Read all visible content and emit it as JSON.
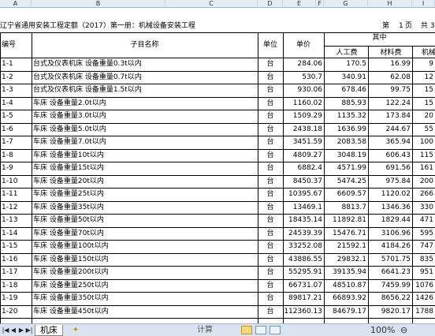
{
  "columns": [
    "A",
    "B",
    "C",
    "D",
    "E",
    "F",
    "G",
    "H",
    "I"
  ],
  "sheet": {
    "title": "辽宁省通用安装工程定额（2017）第一册：机械设备安装工程",
    "page_label": "第",
    "page_num": "1",
    "page_unit": "页",
    "total_label": "共 3",
    "header": {
      "code": "编号",
      "name": "子目名称",
      "unit": "单位",
      "price": "单价",
      "group": "其中",
      "labor": "人工费",
      "material": "材料费",
      "machine": "机械"
    },
    "rows": [
      {
        "code": "1-1",
        "name": "台式及仪表机床 设备重量0.3t以内",
        "unit": "台",
        "price": "284.06",
        "labor": "170.5",
        "material": "16.99",
        "machine": "9"
      },
      {
        "code": "1-2",
        "name": "台式及仪表机床 设备重量0.7t以内",
        "unit": "台",
        "price": "530.7",
        "labor": "340.91",
        "material": "62.08",
        "machine": "12"
      },
      {
        "code": "1-3",
        "name": "台式及仪表机床 设备重量1.5t以内",
        "unit": "台",
        "price": "930.06",
        "labor": "678.46",
        "material": "99.75",
        "machine": "15"
      },
      {
        "code": "1-4",
        "name": "车床 设备重量2.0t以内",
        "unit": "台",
        "price": "1160.02",
        "labor": "885.93",
        "material": "122.24",
        "machine": "15"
      },
      {
        "code": "1-5",
        "name": "车床 设备重量3.0t以内",
        "unit": "台",
        "price": "1509.29",
        "labor": "1135.32",
        "material": "173.84",
        "machine": "20"
      },
      {
        "code": "1-6",
        "name": "车床 设备重量5.0t以内",
        "unit": "台",
        "price": "2438.18",
        "labor": "1636.99",
        "material": "244.67",
        "machine": "55"
      },
      {
        "code": "1-7",
        "name": "车床 设备重量7.0t以内",
        "unit": "台",
        "price": "3451.59",
        "labor": "2083.58",
        "material": "365.94",
        "machine": "100"
      },
      {
        "code": "1-8",
        "name": "车床 设备重量10t以内",
        "unit": "台",
        "price": "4809.27",
        "labor": "3048.19",
        "material": "606.43",
        "machine": "115"
      },
      {
        "code": "1-9",
        "name": "车床 设备重量15t以内",
        "unit": "台",
        "price": "6882.4",
        "labor": "4571.99",
        "material": "691.56",
        "machine": "161"
      },
      {
        "code": "1-10",
        "name": "车床 设备重量20t以内",
        "unit": "台",
        "price": "8450.37",
        "labor": "5474.25",
        "material": "975.84",
        "machine": "200"
      },
      {
        "code": "1-11",
        "name": "车床 设备重量25t以内",
        "unit": "台",
        "price": "10395.67",
        "labor": "6609.57",
        "material": "1120.02",
        "machine": "266"
      },
      {
        "code": "1-12",
        "name": "车床 设备重量35t以内",
        "unit": "台",
        "price": "13469.1",
        "labor": "8813.7",
        "material": "1346.36",
        "machine": "330"
      },
      {
        "code": "1-13",
        "name": "车床 设备重量50t以内",
        "unit": "台",
        "price": "18435.14",
        "labor": "11892.81",
        "material": "1829.44",
        "machine": "471"
      },
      {
        "code": "1-14",
        "name": "车床 设备重量70t以内",
        "unit": "台",
        "price": "24539.39",
        "labor": "15476.71",
        "material": "3106.96",
        "machine": "595"
      },
      {
        "code": "1-15",
        "name": "车床 设备重量100t以内",
        "unit": "台",
        "price": "33252.08",
        "labor": "21592.1",
        "material": "4184.26",
        "machine": "747"
      },
      {
        "code": "1-16",
        "name": "车床 设备重量150t以内",
        "unit": "台",
        "price": "43886.55",
        "labor": "29832.1",
        "material": "5701.75",
        "machine": "835"
      },
      {
        "code": "1-17",
        "name": "车床 设备重量200t以内",
        "unit": "台",
        "price": "55295.91",
        "labor": "39135.94",
        "material": "6641.23",
        "machine": "951"
      },
      {
        "code": "1-18",
        "name": "车床 设备重量250t以内",
        "unit": "台",
        "price": "66731.07",
        "labor": "48510.87",
        "material": "7459.99",
        "machine": "1076"
      },
      {
        "code": "1-19",
        "name": "车床 设备重量350t以内",
        "unit": "台",
        "price": "89817.21",
        "labor": "66893.92",
        "material": "8656.22",
        "machine": "1426"
      },
      {
        "code": "1-20",
        "name": "车床 设备重量450t以内",
        "unit": "台",
        "price": "112360.13",
        "labor": "84679.17",
        "material": "9820.17",
        "machine": "1788"
      }
    ]
  },
  "statusbar": {
    "nav": [
      "|◀",
      "◀",
      "▶",
      "▶|"
    ],
    "tab_label": "机床",
    "new_sheet": "✦",
    "calc_text": "计算",
    "zoom": "100%",
    "zoom_minus": "⊖"
  }
}
